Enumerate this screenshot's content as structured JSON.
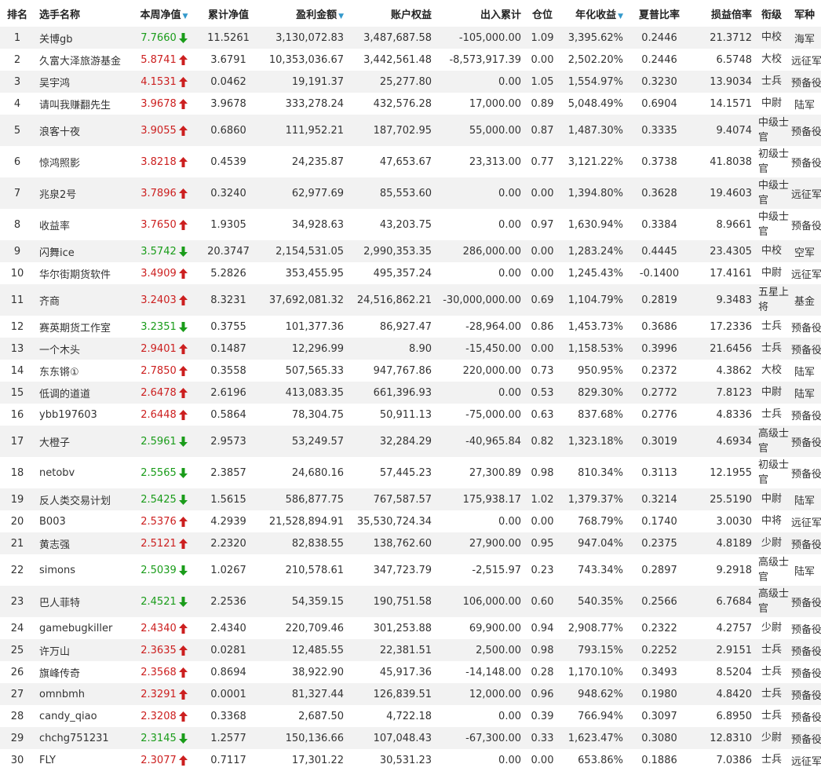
{
  "headers": {
    "rank": "排名",
    "name": "选手名称",
    "weekly_nav": "本周净值",
    "cum_nav": "累计净值",
    "profit": "盈利金额",
    "equity": "账户权益",
    "inout": "出入累计",
    "position": "仓位",
    "annual": "年化收益",
    "sharpe": "夏普比率",
    "pl_ratio": "损益倍率",
    "military_rank": "衔级",
    "army": "军种"
  },
  "colors": {
    "up": "#cc1f1f",
    "down": "#1a9c1a",
    "sort_arrow": "#3399cc",
    "row_stripe": "#f2f2f2"
  },
  "icons": {
    "up": "arrow-up-icon",
    "down": "arrow-down-icon",
    "sort": "sort-desc-icon"
  },
  "rows": [
    {
      "rank": "1",
      "name": "关博gb",
      "nav": "7.7660",
      "dir": "down",
      "cum": "11.5261",
      "profit": "3,130,072.83",
      "equity": "3,487,687.58",
      "inout": "-105,000.00",
      "pos": "1.09",
      "annual": "3,395.62%",
      "sharpe": "0.2446",
      "pl": "21.3712",
      "mil": "中校",
      "army": "海军"
    },
    {
      "rank": "2",
      "name": "久富大泽旅游基金",
      "nav": "5.8741",
      "dir": "up",
      "cum": "3.6791",
      "profit": "10,353,036.67",
      "equity": "3,442,561.48",
      "inout": "-8,573,917.39",
      "pos": "0.00",
      "annual": "2,502.20%",
      "sharpe": "0.2446",
      "pl": "6.5748",
      "mil": "大校",
      "army": "远征军"
    },
    {
      "rank": "3",
      "name": "吴宇鸿",
      "nav": "4.1531",
      "dir": "up",
      "cum": "0.0462",
      "profit": "19,191.37",
      "equity": "25,277.80",
      "inout": "0.00",
      "pos": "1.05",
      "annual": "1,554.97%",
      "sharpe": "0.3230",
      "pl": "13.9034",
      "mil": "士兵",
      "army": "预备役"
    },
    {
      "rank": "4",
      "name": "请叫我赚翻先生",
      "nav": "3.9678",
      "dir": "up",
      "cum": "3.9678",
      "profit": "333,278.24",
      "equity": "432,576.28",
      "inout": "17,000.00",
      "pos": "0.89",
      "annual": "5,048.49%",
      "sharpe": "0.6904",
      "pl": "14.1571",
      "mil": "中尉",
      "army": "陆军"
    },
    {
      "rank": "5",
      "name": "浪客十夜",
      "nav": "3.9055",
      "dir": "up",
      "cum": "0.6860",
      "profit": "111,952.21",
      "equity": "187,702.95",
      "inout": "55,000.00",
      "pos": "0.87",
      "annual": "1,487.30%",
      "sharpe": "0.3335",
      "pl": "9.4074",
      "mil": "中级士官",
      "army": "预备役"
    },
    {
      "rank": "6",
      "name": "惊鸿照影",
      "nav": "3.8218",
      "dir": "up",
      "cum": "0.4539",
      "profit": "24,235.87",
      "equity": "47,653.67",
      "inout": "23,313.00",
      "pos": "0.77",
      "annual": "3,121.22%",
      "sharpe": "0.3738",
      "pl": "41.8038",
      "mil": "初级士官",
      "army": "预备役"
    },
    {
      "rank": "7",
      "name": "兆泉2号",
      "nav": "3.7896",
      "dir": "up",
      "cum": "0.3240",
      "profit": "62,977.69",
      "equity": "85,553.60",
      "inout": "0.00",
      "pos": "0.00",
      "annual": "1,394.80%",
      "sharpe": "0.3628",
      "pl": "19.4603",
      "mil": "中级士官",
      "army": "远征军"
    },
    {
      "rank": "8",
      "name": "收益率",
      "nav": "3.7650",
      "dir": "up",
      "cum": "1.9305",
      "profit": "34,928.63",
      "equity": "43,203.75",
      "inout": "0.00",
      "pos": "0.97",
      "annual": "1,630.94%",
      "sharpe": "0.3384",
      "pl": "8.9661",
      "mil": "中级士官",
      "army": "预备役"
    },
    {
      "rank": "9",
      "name": "闪舞ice",
      "nav": "3.5742",
      "dir": "down",
      "cum": "20.3747",
      "profit": "2,154,531.05",
      "equity": "2,990,353.35",
      "inout": "286,000.00",
      "pos": "0.00",
      "annual": "1,283.24%",
      "sharpe": "0.4445",
      "pl": "23.4305",
      "mil": "中校",
      "army": "空军"
    },
    {
      "rank": "10",
      "name": "华尔街期货软件",
      "nav": "3.4909",
      "dir": "up",
      "cum": "5.2826",
      "profit": "353,455.95",
      "equity": "495,357.24",
      "inout": "0.00",
      "pos": "0.00",
      "annual": "1,245.43%",
      "sharpe": "-0.1400",
      "pl": "17.4161",
      "mil": "中尉",
      "army": "远征军"
    },
    {
      "rank": "11",
      "name": "齐商",
      "nav": "3.2403",
      "dir": "up",
      "cum": "8.3231",
      "profit": "37,692,081.32",
      "equity": "24,516,862.21",
      "inout": "-30,000,000.00",
      "pos": "0.69",
      "annual": "1,104.79%",
      "sharpe": "0.2819",
      "pl": "9.3483",
      "mil": "五星上将",
      "army": "基金"
    },
    {
      "rank": "12",
      "name": "赛英期货工作室",
      "nav": "3.2351",
      "dir": "down",
      "cum": "0.3755",
      "profit": "101,377.36",
      "equity": "86,927.47",
      "inout": "-28,964.00",
      "pos": "0.86",
      "annual": "1,453.73%",
      "sharpe": "0.3686",
      "pl": "17.2336",
      "mil": "士兵",
      "army": "预备役"
    },
    {
      "rank": "13",
      "name": "一个木头",
      "nav": "2.9401",
      "dir": "up",
      "cum": "0.1487",
      "profit": "12,296.99",
      "equity": "8.90",
      "inout": "-15,450.00",
      "pos": "0.00",
      "annual": "1,158.53%",
      "sharpe": "0.3996",
      "pl": "21.6456",
      "mil": "士兵",
      "army": "预备役"
    },
    {
      "rank": "14",
      "name": "东东锵①",
      "nav": "2.7850",
      "dir": "up",
      "cum": "0.3558",
      "profit": "507,565.33",
      "equity": "947,767.86",
      "inout": "220,000.00",
      "pos": "0.73",
      "annual": "950.95%",
      "sharpe": "0.2372",
      "pl": "4.3862",
      "mil": "大校",
      "army": "陆军"
    },
    {
      "rank": "15",
      "name": "低调的道道",
      "nav": "2.6478",
      "dir": "up",
      "cum": "2.6196",
      "profit": "413,083.35",
      "equity": "661,396.93",
      "inout": "0.00",
      "pos": "0.53",
      "annual": "829.30%",
      "sharpe": "0.2772",
      "pl": "7.8123",
      "mil": "中尉",
      "army": "陆军"
    },
    {
      "rank": "16",
      "name": "ybb197603",
      "nav": "2.6448",
      "dir": "up",
      "cum": "0.5864",
      "profit": "78,304.75",
      "equity": "50,911.13",
      "inout": "-75,000.00",
      "pos": "0.63",
      "annual": "837.68%",
      "sharpe": "0.2776",
      "pl": "4.8336",
      "mil": "士兵",
      "army": "预备役"
    },
    {
      "rank": "17",
      "name": "大橙子",
      "nav": "2.5961",
      "dir": "down",
      "cum": "2.9573",
      "profit": "53,249.57",
      "equity": "32,284.29",
      "inout": "-40,965.84",
      "pos": "0.82",
      "annual": "1,323.18%",
      "sharpe": "0.3019",
      "pl": "4.6934",
      "mil": "高级士官",
      "army": "预备役"
    },
    {
      "rank": "18",
      "name": "netobv",
      "nav": "2.5565",
      "dir": "down",
      "cum": "2.3857",
      "profit": "24,680.16",
      "equity": "57,445.23",
      "inout": "27,300.89",
      "pos": "0.98",
      "annual": "810.34%",
      "sharpe": "0.3113",
      "pl": "12.1955",
      "mil": "初级士官",
      "army": "预备役"
    },
    {
      "rank": "19",
      "name": "反人类交易计划",
      "nav": "2.5425",
      "dir": "down",
      "cum": "1.5615",
      "profit": "586,877.75",
      "equity": "767,587.57",
      "inout": "175,938.17",
      "pos": "1.02",
      "annual": "1,379.37%",
      "sharpe": "0.3214",
      "pl": "25.5190",
      "mil": "中尉",
      "army": "陆军"
    },
    {
      "rank": "20",
      "name": "B003",
      "nav": "2.5376",
      "dir": "up",
      "cum": "4.2939",
      "profit": "21,528,894.91",
      "equity": "35,530,724.34",
      "inout": "0.00",
      "pos": "0.00",
      "annual": "768.79%",
      "sharpe": "0.1740",
      "pl": "3.0030",
      "mil": "中将",
      "army": "远征军"
    },
    {
      "rank": "21",
      "name": "黄志强",
      "nav": "2.5121",
      "dir": "up",
      "cum": "2.2320",
      "profit": "82,838.55",
      "equity": "138,762.60",
      "inout": "27,900.00",
      "pos": "0.95",
      "annual": "947.04%",
      "sharpe": "0.2375",
      "pl": "4.8189",
      "mil": "少尉",
      "army": "预备役"
    },
    {
      "rank": "22",
      "name": "simons",
      "nav": "2.5039",
      "dir": "down",
      "cum": "1.0267",
      "profit": "210,578.61",
      "equity": "347,723.79",
      "inout": "-2,515.97",
      "pos": "0.23",
      "annual": "743.34%",
      "sharpe": "0.2897",
      "pl": "9.2918",
      "mil": "高级士官",
      "army": "陆军"
    },
    {
      "rank": "23",
      "name": "巴人菲特",
      "nav": "2.4521",
      "dir": "down",
      "cum": "2.2536",
      "profit": "54,359.15",
      "equity": "190,751.58",
      "inout": "106,000.00",
      "pos": "0.60",
      "annual": "540.35%",
      "sharpe": "0.2566",
      "pl": "6.7684",
      "mil": "高级士官",
      "army": "预备役"
    },
    {
      "rank": "24",
      "name": "gamebugkiller",
      "nav": "2.4340",
      "dir": "up",
      "cum": "2.4340",
      "profit": "220,709.46",
      "equity": "301,253.88",
      "inout": "69,900.00",
      "pos": "0.94",
      "annual": "2,908.77%",
      "sharpe": "0.2322",
      "pl": "4.2757",
      "mil": "少尉",
      "army": "预备役"
    },
    {
      "rank": "25",
      "name": "许万山",
      "nav": "2.3635",
      "dir": "up",
      "cum": "0.0281",
      "profit": "12,485.55",
      "equity": "22,381.51",
      "inout": "2,500.00",
      "pos": "0.98",
      "annual": "793.15%",
      "sharpe": "0.2252",
      "pl": "2.9151",
      "mil": "士兵",
      "army": "预备役"
    },
    {
      "rank": "26",
      "name": "旗峰传奇",
      "nav": "2.3568",
      "dir": "up",
      "cum": "0.8694",
      "profit": "38,922.90",
      "equity": "45,917.36",
      "inout": "-14,148.00",
      "pos": "0.28",
      "annual": "1,170.10%",
      "sharpe": "0.3493",
      "pl": "8.5204",
      "mil": "士兵",
      "army": "预备役"
    },
    {
      "rank": "27",
      "name": "omnbmh",
      "nav": "2.3291",
      "dir": "up",
      "cum": "0.0001",
      "profit": "81,327.44",
      "equity": "126,839.51",
      "inout": "12,000.00",
      "pos": "0.96",
      "annual": "948.62%",
      "sharpe": "0.1980",
      "pl": "4.8420",
      "mil": "士兵",
      "army": "预备役"
    },
    {
      "rank": "28",
      "name": "candy_qiao",
      "nav": "2.3208",
      "dir": "up",
      "cum": "0.3368",
      "profit": "2,687.50",
      "equity": "4,722.18",
      "inout": "0.00",
      "pos": "0.39",
      "annual": "766.94%",
      "sharpe": "0.3097",
      "pl": "6.8950",
      "mil": "士兵",
      "army": "预备役"
    },
    {
      "rank": "29",
      "name": "chchg751231",
      "nav": "2.3145",
      "dir": "down",
      "cum": "1.2577",
      "profit": "150,136.66",
      "equity": "107,048.43",
      "inout": "-67,300.00",
      "pos": "0.33",
      "annual": "1,623.47%",
      "sharpe": "0.3080",
      "pl": "12.8310",
      "mil": "少尉",
      "army": "预备役"
    },
    {
      "rank": "30",
      "name": "FLY",
      "nav": "2.3077",
      "dir": "up",
      "cum": "0.7117",
      "profit": "17,301.22",
      "equity": "30,531.23",
      "inout": "0.00",
      "pos": "0.00",
      "annual": "653.86%",
      "sharpe": "0.1886",
      "pl": "7.0386",
      "mil": "士兵",
      "army": "远征军"
    }
  ]
}
